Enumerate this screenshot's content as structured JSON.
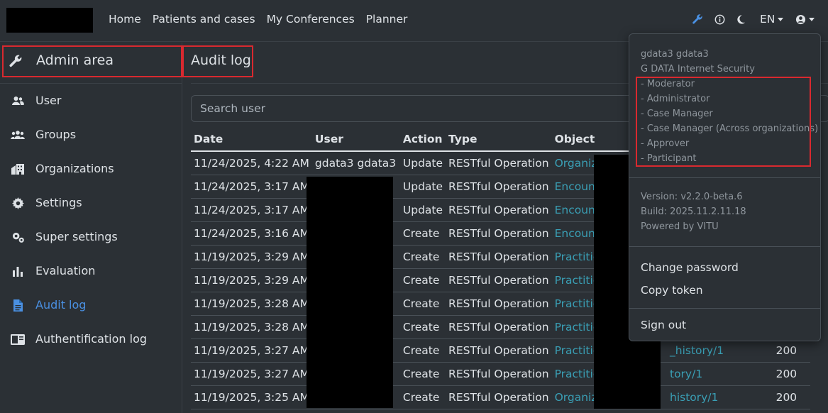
{
  "topbar": {
    "nav": [
      "Home",
      "Patients and cases",
      "My Conferences",
      "Planner"
    ],
    "tools": {
      "admin_icon": "wrench-icon",
      "info_icon": "info-circle-icon",
      "theme_icon": "moon-icon",
      "language": "EN",
      "user_icon": "user-circle-icon",
      "accent": "#4a90e2"
    }
  },
  "sidebar": {
    "title": "Admin area",
    "items": [
      {
        "label": "User",
        "icon": "user-icon"
      },
      {
        "label": "Groups",
        "icon": "groups-icon"
      },
      {
        "label": "Organizations",
        "icon": "organization-icon"
      },
      {
        "label": "Settings",
        "icon": "gear-icon"
      },
      {
        "label": "Super settings",
        "icon": "gears-icon"
      },
      {
        "label": "Evaluation",
        "icon": "bar-chart-icon"
      },
      {
        "label": "Audit log",
        "icon": "document-icon",
        "active": true
      },
      {
        "label": "Authentification log",
        "icon": "id-card-icon"
      }
    ]
  },
  "main": {
    "title": "Audit log",
    "search_placeholder": "Search user",
    "columns": [
      "Date",
      "User",
      "Action",
      "Type",
      "Object"
    ],
    "rows": [
      {
        "date": "11/24/2025, 4:22 AM",
        "user": "gdata3 gdata3",
        "action": "Update",
        "type": "RESTful Operation",
        "object": "Organizat",
        "status": ""
      },
      {
        "date": "11/24/2025, 3:17 AM",
        "user": "",
        "action": "Update",
        "type": "RESTful Operation",
        "object": "Encounte",
        "status": ""
      },
      {
        "date": "11/24/2025, 3:17 AM",
        "user": "",
        "action": "Update",
        "type": "RESTful Operation",
        "object": "Encounte",
        "status": ""
      },
      {
        "date": "11/24/2025, 3:16 AM",
        "user": "",
        "action": "Create",
        "type": "RESTful Operation",
        "object": "Encounte",
        "status": ""
      },
      {
        "date": "11/19/2025, 3:29 AM",
        "user": "",
        "action": "Create",
        "type": "RESTful Operation",
        "object": "Practition",
        "status": ""
      },
      {
        "date": "11/19/2025, 3:29 AM",
        "user": "",
        "action": "Create",
        "type": "RESTful Operation",
        "object": "Practition",
        "status": ""
      },
      {
        "date": "11/19/2025, 3:28 AM",
        "user": "",
        "action": "Create",
        "type": "RESTful Operation",
        "object": "Practition",
        "status": ""
      },
      {
        "date": "11/19/2025, 3:28 AM",
        "user": "",
        "action": "Create",
        "type": "RESTful Operation",
        "object": "Practition",
        "status": ""
      },
      {
        "date": "11/19/2025, 3:27 AM",
        "user": "",
        "action": "Create",
        "type": "RESTful Operation",
        "object": "Practition",
        "object_tail": "_history/1",
        "status": "200"
      },
      {
        "date": "11/19/2025, 3:27 AM",
        "user": "",
        "action": "Create",
        "type": "RESTful Operation",
        "object": "Practition",
        "object_tail": "tory/1",
        "status": "200"
      },
      {
        "date": "11/19/2025, 3:25 AM",
        "user": "",
        "action": "Create",
        "type": "RESTful Operation",
        "object": "Organizat",
        "object_tail": "history/1",
        "status": "200"
      }
    ]
  },
  "dropdown": {
    "user_name": "gdata3 gdata3",
    "organization": "G DATA Internet Security",
    "roles": [
      "- Moderator",
      "- Administrator",
      "- Case Manager",
      "- Case Manager (Across organizations)",
      "- Approver",
      "- Participant"
    ],
    "version": "Version: v2.2.0-beta.6",
    "build": "Build: 2025.11.2.11.18",
    "powered": "Powered by VITU",
    "change_password": "Change password",
    "copy_token": "Copy token",
    "sign_out": "Sign out"
  },
  "annotation_color": "#d9292f"
}
